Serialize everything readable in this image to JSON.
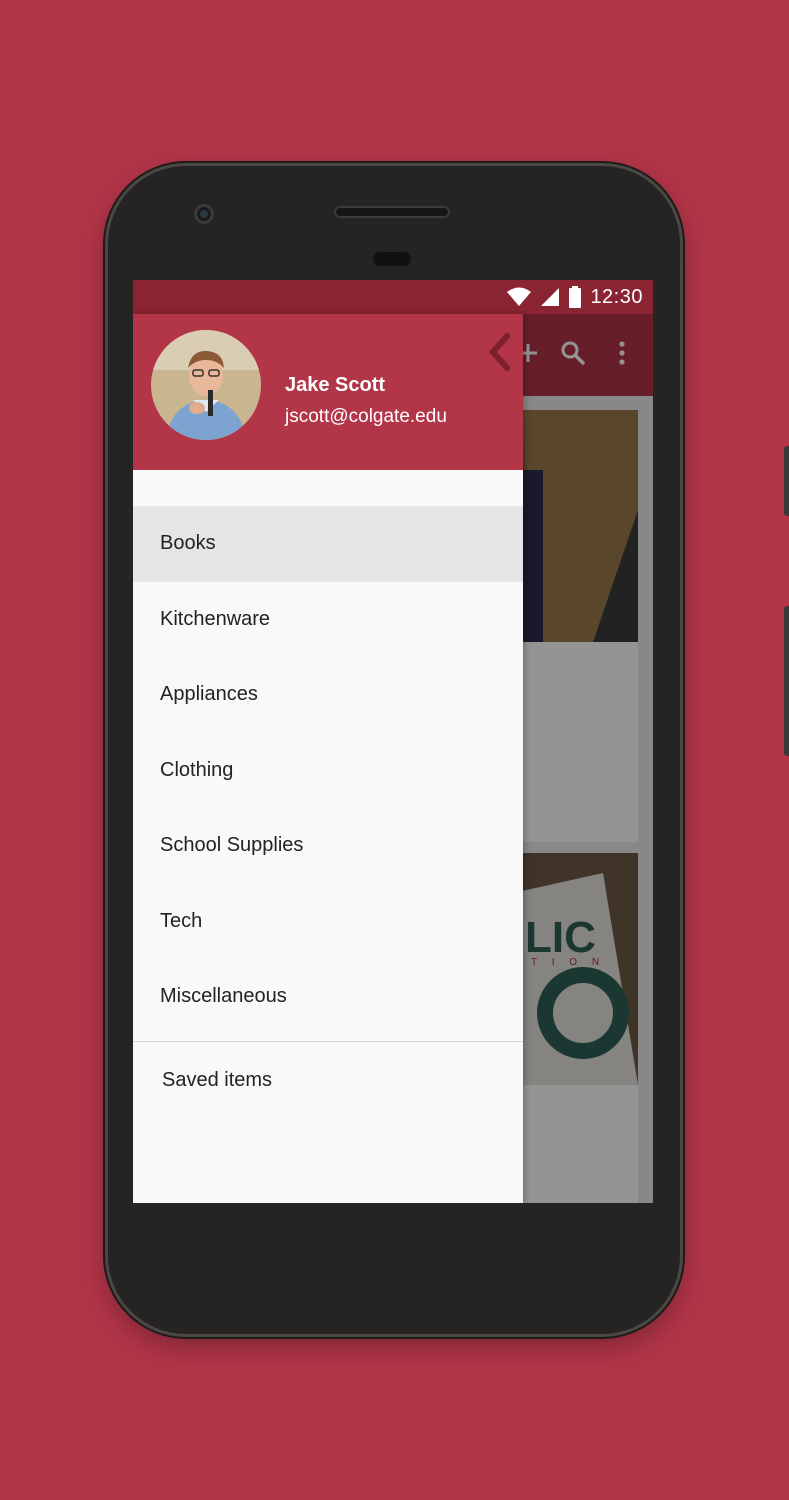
{
  "status_bar": {
    "time": "12:30",
    "icons": [
      "wifi-icon",
      "cell-signal-icon",
      "battery-icon"
    ]
  },
  "app_bar": {
    "icons": [
      "add-icon",
      "search-icon",
      "more-vert-icon"
    ]
  },
  "drawer": {
    "user": {
      "name": "Jake Scott",
      "email": "jscott@colgate.edu"
    },
    "categories": [
      "Books",
      "Kitchenware",
      "Appliances",
      "Clothing",
      "School Supplies",
      "Tech",
      "Miscellaneous"
    ],
    "selected": "Books",
    "saved_label": "Saved items"
  },
  "background_card_text": {
    "line1": "LIC",
    "line2": "T I O N",
    "line3": "O"
  },
  "colors": {
    "brand": "#b23548",
    "brand_dark": "#8b2432",
    "selected_bg": "#e5e5e5"
  }
}
